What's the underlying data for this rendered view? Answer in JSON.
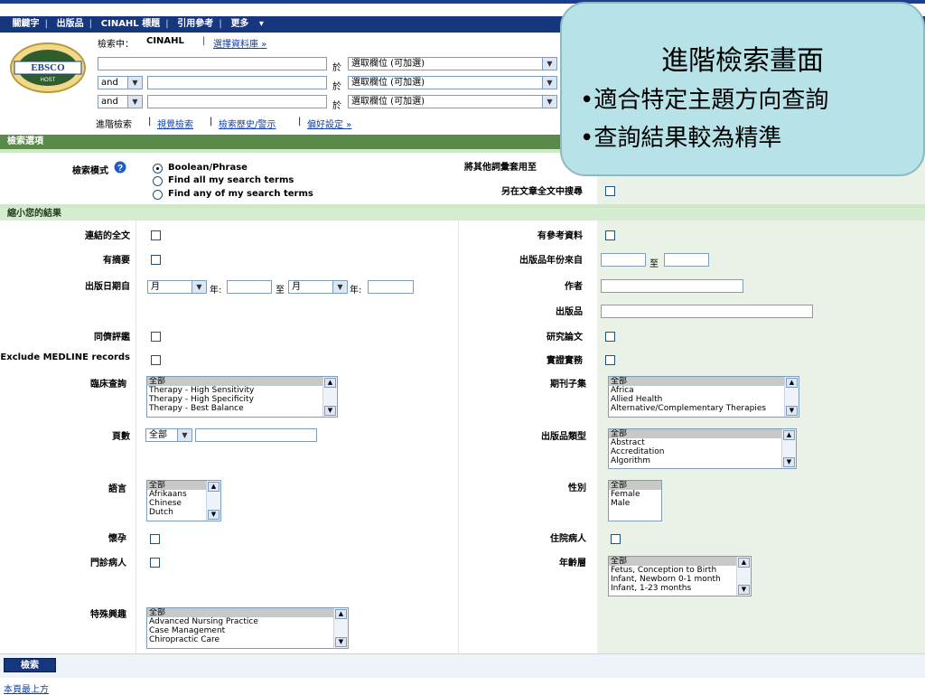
{
  "topnav": {
    "items": [
      "關鍵字",
      "出版品",
      "CINAHL 標題",
      "引用參考",
      "更多"
    ],
    "more_arrow": "▾"
  },
  "logo": {
    "text": "EBSCO",
    "sub": "HOST"
  },
  "database": {
    "label": "檢索中：",
    "name": "CINAHL",
    "choose_link": "選擇資料庫 »"
  },
  "search_rows": [
    {
      "operator": "",
      "value": "",
      "in_label": "於",
      "field": "選取欄位 (可加選)"
    },
    {
      "operator": "and",
      "value": "",
      "in_label": "於",
      "field": "選取欄位 (可加選)"
    },
    {
      "operator": "and",
      "value": "",
      "in_label": "於",
      "field": "選取欄位 (可加選)"
    }
  ],
  "links": {
    "advanced": "進階檢索",
    "visual": "視覺檢索",
    "history": "檢索歷史/警示",
    "preferences": "偏好設定 »"
  },
  "search_options": {
    "header": "檢索選項",
    "mode_label": "檢索模式",
    "modes": [
      "Boolean/Phrase",
      "Find all my search terms",
      "Find any of my search terms"
    ],
    "apply_related_label": "將其他詞彙套用至",
    "fulltext_label": "另在文章全文中搜尋"
  },
  "limit": {
    "header": "縮小您的結果",
    "linked_fulltext": "連結的全文",
    "has_references": "有參考資料",
    "abstract_available": "有摘要",
    "pub_year_from": "出版品年份來自",
    "pub_year_to": "至",
    "pub_date_from": "出版日期自",
    "month_default": "月",
    "year_label": "年:",
    "date_to": "至",
    "author": "作者",
    "publication": "出版品",
    "peer_reviewed": "同儕評鑑",
    "research_article": "研究論文",
    "exclude_medline": "Exclude MEDLINE records",
    "evidence_based": "實證實務",
    "clinical_queries": "臨床查詢",
    "clinical_options": [
      "全部",
      "Therapy - High Sensitivity",
      "Therapy - High Specificity",
      "Therapy - Best Balance"
    ],
    "journal_subset": "期刊子集",
    "journal_options": [
      "全部",
      "Africa",
      "Allied Health",
      "Alternative/Complementary Therapies"
    ],
    "pages": "頁數",
    "pages_default": "全部",
    "pub_type": "出版品類型",
    "pub_type_options": [
      "全部",
      "Abstract",
      "Accreditation",
      "Algorithm"
    ],
    "language": "語言",
    "language_options": [
      "全部",
      "Afrikaans",
      "Chinese",
      "Dutch"
    ],
    "gender": "性別",
    "gender_options": [
      "全部",
      "Female",
      "Male"
    ],
    "pregnancy": "懷孕",
    "inpatient": "住院病人",
    "outpatient": "門診病人",
    "age_groups": "年齡層",
    "age_options": [
      "全部",
      "Fetus, Conception to Birth",
      "Infant, Newborn 0-1 month",
      "Infant, 1-23 months"
    ],
    "special_interest": "特殊興趣",
    "special_options": [
      "全部",
      "Advanced Nursing Practice",
      "Case Management",
      "Chiropractic Care"
    ]
  },
  "search_button": "檢索",
  "top_link": "本頁最上方",
  "callout": {
    "title": "進階檢索畫面",
    "line1": "•適合特定主題方向查詢",
    "line2": "•查詢結果較為精準"
  },
  "colors": {
    "nav": "#16367e",
    "bar": "#5a8a4a",
    "panel": "#eaf1e6",
    "callout": "#b7e2e7"
  }
}
